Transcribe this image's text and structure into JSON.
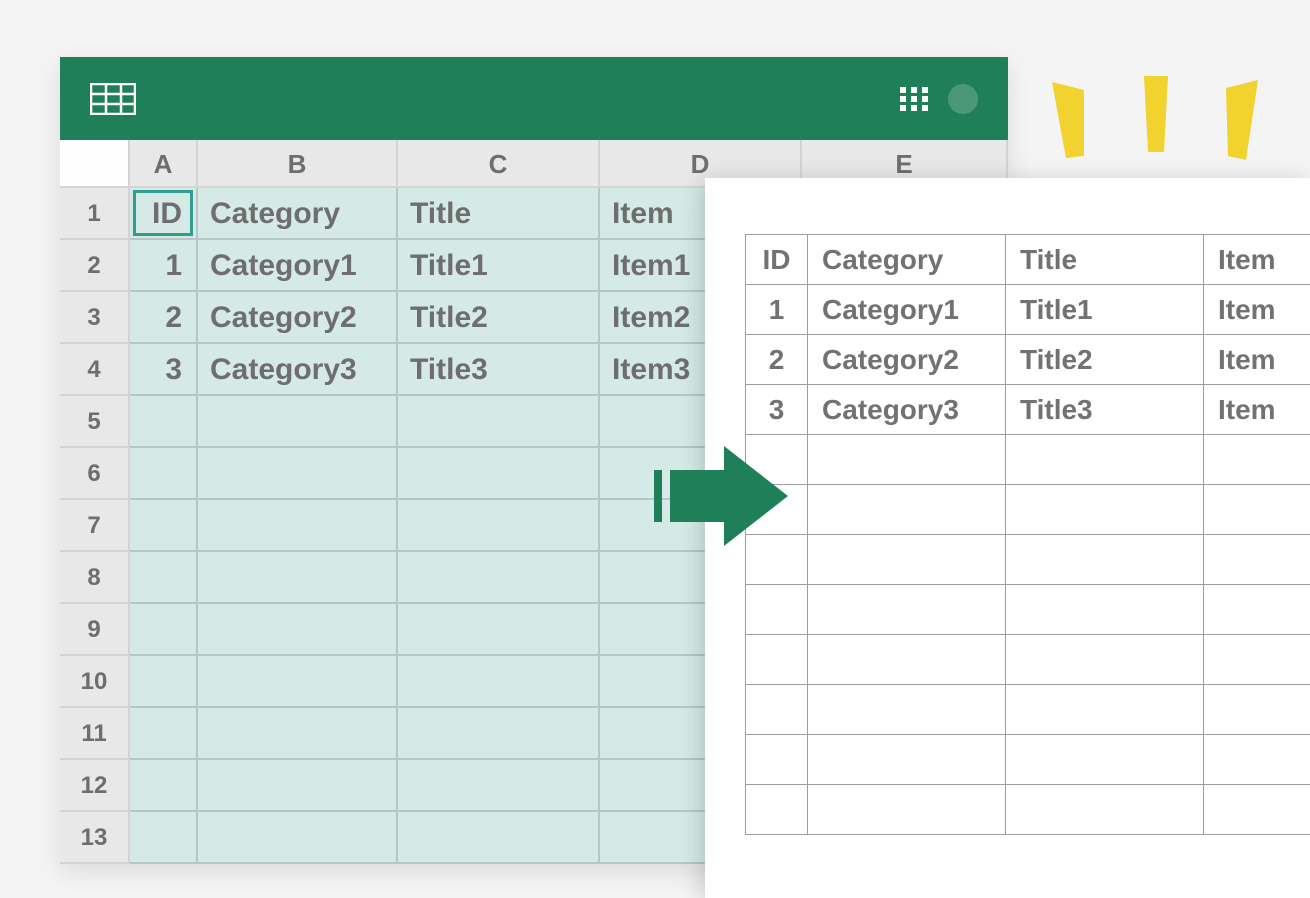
{
  "colors": {
    "brand_green": "#1f7f59",
    "selection_teal": "#d5eae6",
    "active_border": "#2f9e8f",
    "sparkle_yellow": "#f2d22e"
  },
  "spreadsheet": {
    "columns": [
      "A",
      "B",
      "C",
      "D",
      "E"
    ],
    "row_numbers": [
      "1",
      "2",
      "3",
      "4",
      "5",
      "6",
      "7",
      "8",
      "9",
      "10",
      "11",
      "12",
      "13"
    ],
    "active_cell": "A1",
    "headers": {
      "id": "ID",
      "category": "Category",
      "title": "Title",
      "item": "Item"
    },
    "rows": [
      {
        "id": "1",
        "category": "Category1",
        "title": "Title1",
        "item": "Item1"
      },
      {
        "id": "2",
        "category": "Category2",
        "title": "Title2",
        "item": "Item2"
      },
      {
        "id": "3",
        "category": "Category3",
        "title": "Title3",
        "item": "Item3"
      }
    ]
  },
  "plain_table": {
    "headers": {
      "id": "ID",
      "category": "Category",
      "title": "Title",
      "item": "Item"
    },
    "rows": [
      {
        "id": "1",
        "category": "Category1",
        "title": "Title1",
        "item": "Item"
      },
      {
        "id": "2",
        "category": "Category2",
        "title": "Title2",
        "item": "Item"
      },
      {
        "id": "3",
        "category": "Category3",
        "title": "Title3",
        "item": "Item"
      }
    ],
    "blank_row_count": 8
  }
}
